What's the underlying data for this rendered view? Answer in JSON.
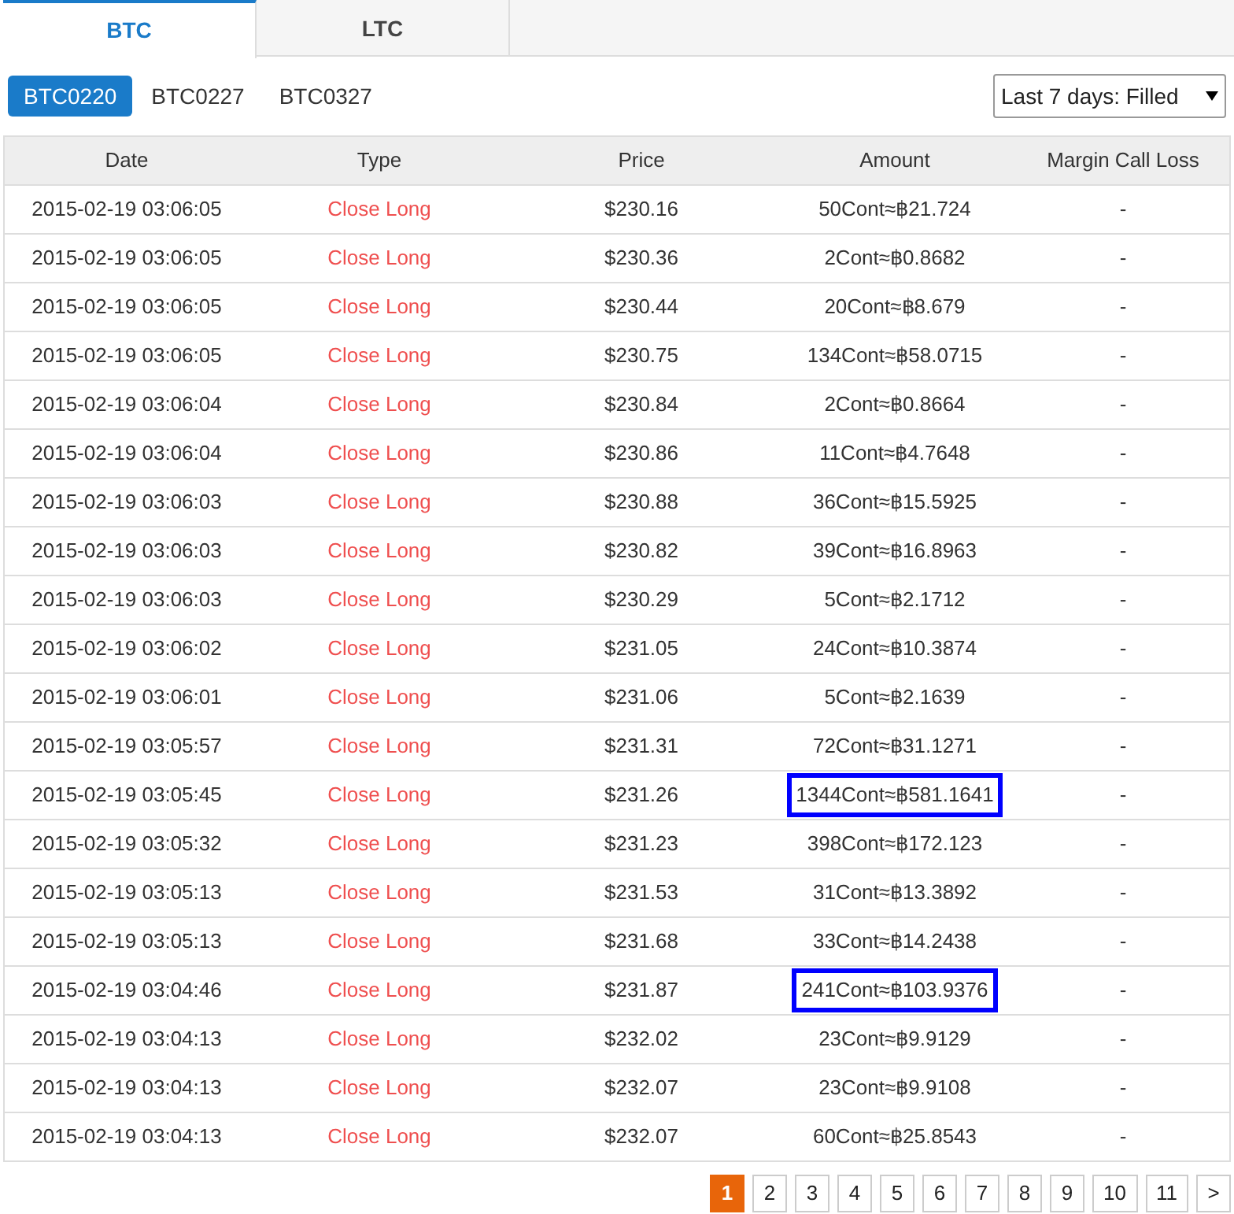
{
  "tabs": [
    {
      "label": "BTC",
      "selected": true
    },
    {
      "label": "LTC",
      "selected": false
    }
  ],
  "contracts": [
    {
      "label": "BTC0220",
      "selected": true
    },
    {
      "label": "BTC0227",
      "selected": false
    },
    {
      "label": "BTC0327",
      "selected": false
    }
  ],
  "filter": {
    "value": "Last 7 days: Filled"
  },
  "table": {
    "columns": [
      "Date",
      "Type",
      "Price",
      "Amount",
      "Margin Call Loss"
    ],
    "rows": [
      {
        "date": "2015-02-19 03:06:05",
        "type": "Close Long",
        "price": "$230.16",
        "amount": "50Cont≈฿21.724",
        "loss": "-",
        "highlighted": false
      },
      {
        "date": "2015-02-19 03:06:05",
        "type": "Close Long",
        "price": "$230.36",
        "amount": "2Cont≈฿0.8682",
        "loss": "-",
        "highlighted": false
      },
      {
        "date": "2015-02-19 03:06:05",
        "type": "Close Long",
        "price": "$230.44",
        "amount": "20Cont≈฿8.679",
        "loss": "-",
        "highlighted": false
      },
      {
        "date": "2015-02-19 03:06:05",
        "type": "Close Long",
        "price": "$230.75",
        "amount": "134Cont≈฿58.0715",
        "loss": "-",
        "highlighted": false
      },
      {
        "date": "2015-02-19 03:06:04",
        "type": "Close Long",
        "price": "$230.84",
        "amount": "2Cont≈฿0.8664",
        "loss": "-",
        "highlighted": false
      },
      {
        "date": "2015-02-19 03:06:04",
        "type": "Close Long",
        "price": "$230.86",
        "amount": "11Cont≈฿4.7648",
        "loss": "-",
        "highlighted": false
      },
      {
        "date": "2015-02-19 03:06:03",
        "type": "Close Long",
        "price": "$230.88",
        "amount": "36Cont≈฿15.5925",
        "loss": "-",
        "highlighted": false
      },
      {
        "date": "2015-02-19 03:06:03",
        "type": "Close Long",
        "price": "$230.82",
        "amount": "39Cont≈฿16.8963",
        "loss": "-",
        "highlighted": false
      },
      {
        "date": "2015-02-19 03:06:03",
        "type": "Close Long",
        "price": "$230.29",
        "amount": "5Cont≈฿2.1712",
        "loss": "-",
        "highlighted": false
      },
      {
        "date": "2015-02-19 03:06:02",
        "type": "Close Long",
        "price": "$231.05",
        "amount": "24Cont≈฿10.3874",
        "loss": "-",
        "highlighted": false
      },
      {
        "date": "2015-02-19 03:06:01",
        "type": "Close Long",
        "price": "$231.06",
        "amount": "5Cont≈฿2.1639",
        "loss": "-",
        "highlighted": false
      },
      {
        "date": "2015-02-19 03:05:57",
        "type": "Close Long",
        "price": "$231.31",
        "amount": "72Cont≈฿31.1271",
        "loss": "-",
        "highlighted": false
      },
      {
        "date": "2015-02-19 03:05:45",
        "type": "Close Long",
        "price": "$231.26",
        "amount": "1344Cont≈฿581.1641",
        "loss": "-",
        "highlighted": true
      },
      {
        "date": "2015-02-19 03:05:32",
        "type": "Close Long",
        "price": "$231.23",
        "amount": "398Cont≈฿172.123",
        "loss": "-",
        "highlighted": false
      },
      {
        "date": "2015-02-19 03:05:13",
        "type": "Close Long",
        "price": "$231.53",
        "amount": "31Cont≈฿13.3892",
        "loss": "-",
        "highlighted": false
      },
      {
        "date": "2015-02-19 03:05:13",
        "type": "Close Long",
        "price": "$231.68",
        "amount": "33Cont≈฿14.2438",
        "loss": "-",
        "highlighted": false
      },
      {
        "date": "2015-02-19 03:04:46",
        "type": "Close Long",
        "price": "$231.87",
        "amount": "241Cont≈฿103.9376",
        "loss": "-",
        "highlighted": true
      },
      {
        "date": "2015-02-19 03:04:13",
        "type": "Close Long",
        "price": "$232.02",
        "amount": "23Cont≈฿9.9129",
        "loss": "-",
        "highlighted": false
      },
      {
        "date": "2015-02-19 03:04:13",
        "type": "Close Long",
        "price": "$232.07",
        "amount": "23Cont≈฿9.9108",
        "loss": "-",
        "highlighted": false
      },
      {
        "date": "2015-02-19 03:04:13",
        "type": "Close Long",
        "price": "$232.07",
        "amount": "60Cont≈฿25.8543",
        "loss": "-",
        "highlighted": false
      }
    ]
  },
  "pagination": [
    {
      "label": "1",
      "selected": true
    },
    {
      "label": "2",
      "selected": false
    },
    {
      "label": "3",
      "selected": false
    },
    {
      "label": "4",
      "selected": false
    },
    {
      "label": "5",
      "selected": false
    },
    {
      "label": "6",
      "selected": false
    },
    {
      "label": "7",
      "selected": false
    },
    {
      "label": "8",
      "selected": false
    },
    {
      "label": "9",
      "selected": false
    },
    {
      "label": "10",
      "selected": false
    },
    {
      "label": "11",
      "selected": false
    },
    {
      "label": ">",
      "selected": false
    }
  ]
}
